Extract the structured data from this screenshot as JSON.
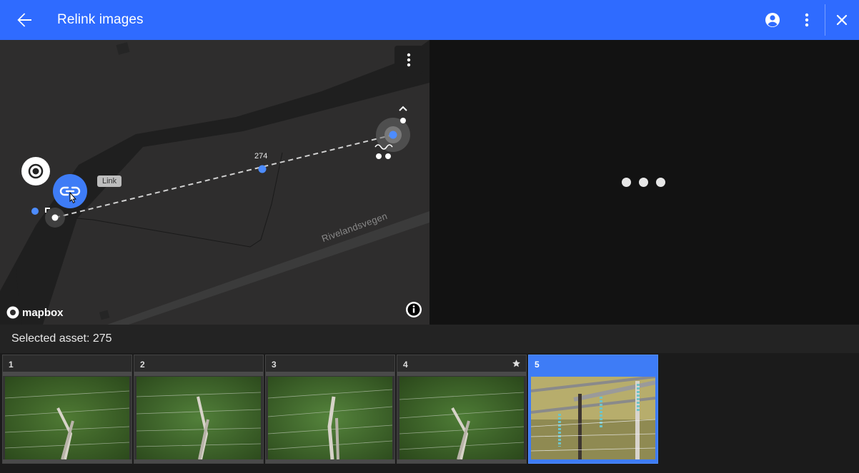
{
  "header": {
    "title": "Relink images"
  },
  "map": {
    "tooltip": "Link",
    "marker_label": "274",
    "road_label": "Rivelandsvegen",
    "attribution": "mapbox"
  },
  "status": {
    "selected_asset": "Selected asset: 275"
  },
  "thumbnails": [
    {
      "number": "1",
      "starred": false,
      "selected": false
    },
    {
      "number": "2",
      "starred": false,
      "selected": false
    },
    {
      "number": "3",
      "starred": false,
      "selected": false
    },
    {
      "number": "4",
      "starred": true,
      "selected": false
    },
    {
      "number": "5",
      "starred": false,
      "selected": true
    }
  ],
  "colors": {
    "appbar": "#2f6bff",
    "accent": "#3e7cf6",
    "viewer_bg": "#121212",
    "map_bg": "#2e2d2d"
  }
}
